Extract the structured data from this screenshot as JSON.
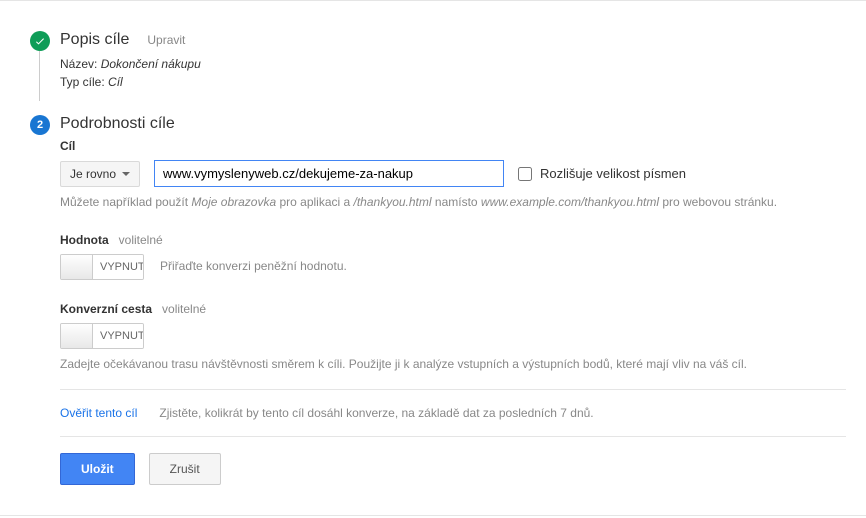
{
  "step1": {
    "title": "Popis cíle",
    "edit_label": "Upravit",
    "name_label": "Název:",
    "name_value": "Dokončení nákupu",
    "type_label": "Typ cíle:",
    "type_value": "Cíl"
  },
  "step2": {
    "number": "2",
    "title": "Podrobnosti cíle",
    "goal": {
      "label": "Cíl",
      "match_type": "Je rovno",
      "url_value": "www.vymyslenyweb.cz/dekujeme-za-nakup",
      "case_label": "Rozlišuje velikost písmen",
      "hint_prefix": "Můžete například použít ",
      "hint_ital1": "Moje obrazovka",
      "hint_mid1": " pro aplikaci a ",
      "hint_ital2": "/thankyou.html",
      "hint_mid2": " namísto ",
      "hint_ital3": "www.example.com/thankyou.html",
      "hint_suffix": " pro webovou stránku."
    },
    "value": {
      "label": "Hodnota",
      "optional": "volitelné",
      "toggle_state": "VYPNUTO",
      "hint": "Přiřaďte konverzi peněžní hodnotu."
    },
    "funnel": {
      "label": "Konverzní cesta",
      "optional": "volitelné",
      "toggle_state": "VYPNUTO",
      "hint": "Zadejte očekávanou trasu návštěvnosti směrem k cíli. Použijte ji k analýze vstupních a výstupních bodů, které mají vliv na váš cíl."
    },
    "verify": {
      "link": "Ověřit tento cíl",
      "text": "Zjistěte, kolikrát by tento cíl dosáhl konverze, na základě dat za posledních 7 dnů."
    },
    "buttons": {
      "save": "Uložit",
      "cancel": "Zrušit"
    }
  }
}
